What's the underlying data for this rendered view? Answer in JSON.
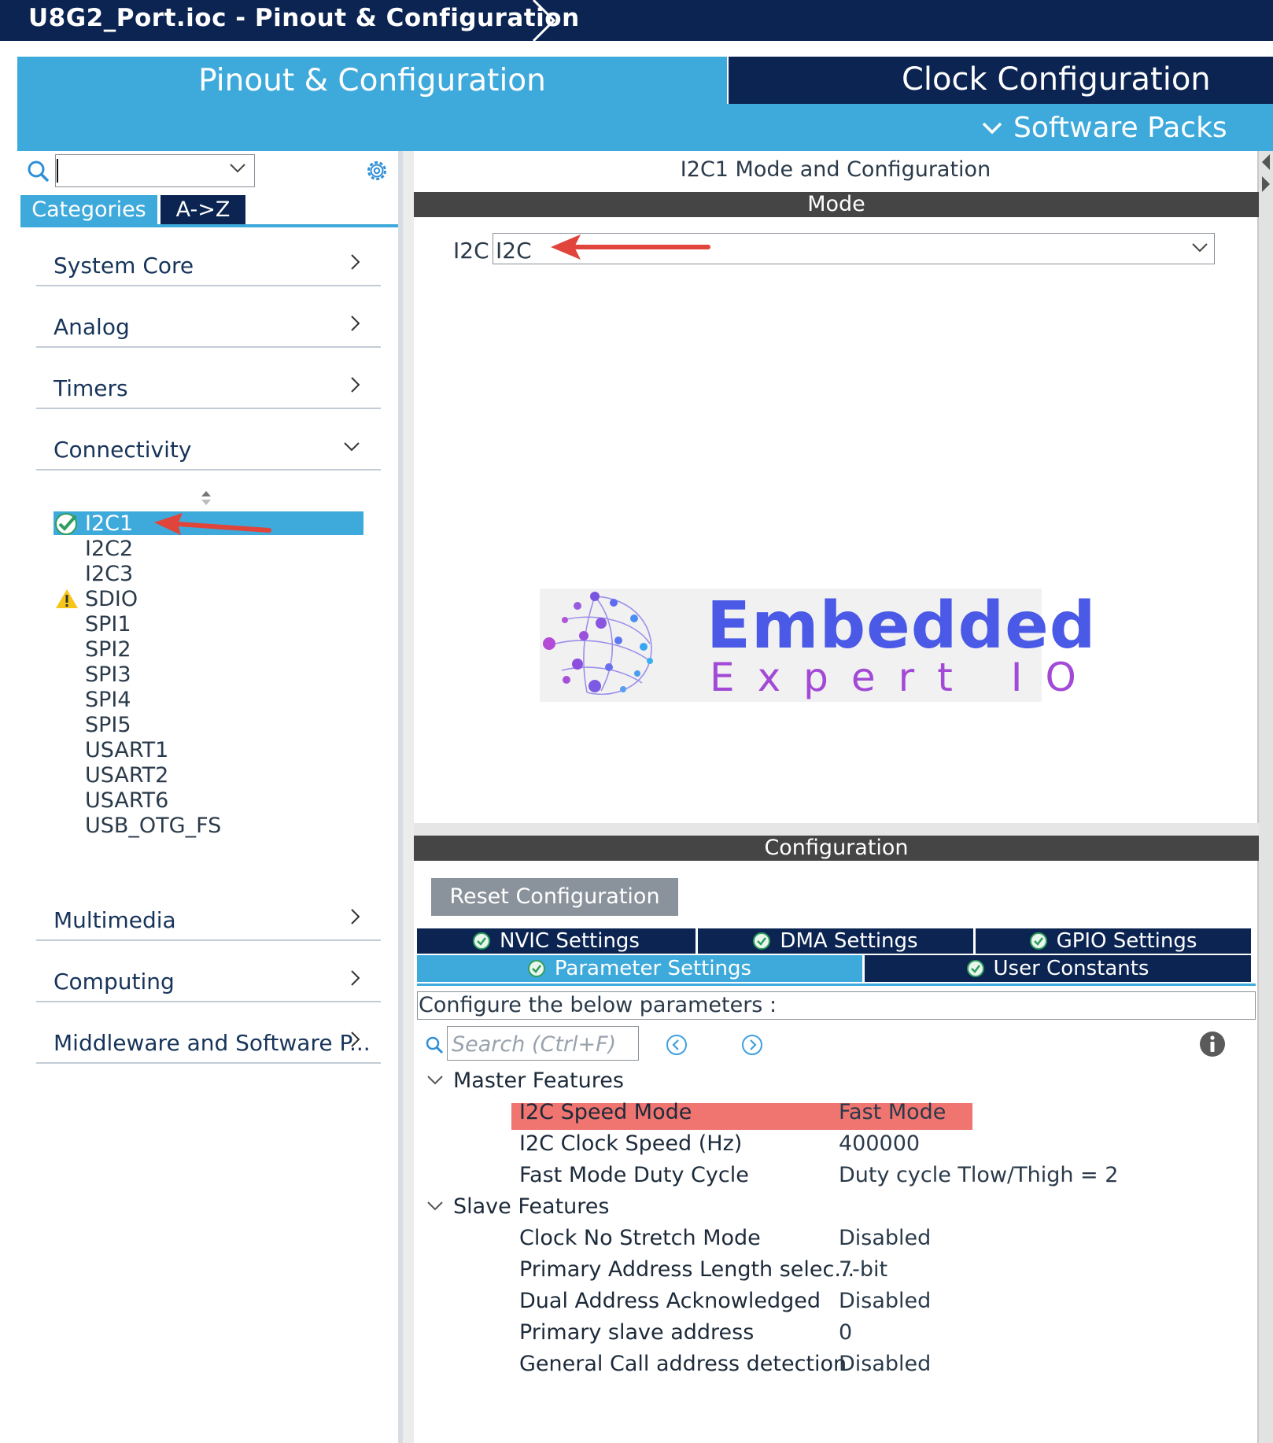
{
  "window": {
    "title": "U8G2_Port.ioc - Pinout & Configuration"
  },
  "top_tabs": {
    "pinout": "Pinout & Configuration",
    "clock": "Clock Configuration",
    "software_packs": "Software Packs"
  },
  "left_panel": {
    "search": {
      "value": "",
      "placeholder": ""
    },
    "tabs": {
      "categories": "Categories",
      "az": "A->Z"
    },
    "categories": [
      "System Core",
      "Analog",
      "Timers",
      "Connectivity",
      "Multimedia",
      "Computing",
      "Middleware and Software P..."
    ],
    "connectivity_items": [
      {
        "label": "I2C1",
        "status": "check"
      },
      {
        "label": "I2C2",
        "status": ""
      },
      {
        "label": "I2C3",
        "status": ""
      },
      {
        "label": "SDIO",
        "status": "warning"
      },
      {
        "label": "SPI1",
        "status": ""
      },
      {
        "label": "SPI2",
        "status": ""
      },
      {
        "label": "SPI3",
        "status": ""
      },
      {
        "label": "SPI4",
        "status": ""
      },
      {
        "label": "SPI5",
        "status": ""
      },
      {
        "label": "USART1",
        "status": ""
      },
      {
        "label": "USART2",
        "status": ""
      },
      {
        "label": "USART6",
        "status": ""
      },
      {
        "label": "USB_OTG_FS",
        "status": ""
      }
    ],
    "selected_item": "I2C1"
  },
  "mode": {
    "title": "I2C1 Mode and Configuration",
    "section": "Mode",
    "i2c_label": "I2C",
    "i2c_value": "I2C"
  },
  "logo": {
    "word1": "Embedded",
    "word2": "Expert IO"
  },
  "configuration": {
    "section": "Configuration",
    "reset_button": "Reset Configuration",
    "tabs": {
      "nvic": "NVIC Settings",
      "dma": "DMA Settings",
      "gpio": "GPIO Settings",
      "parameter": "Parameter Settings",
      "user_constants": "User Constants"
    },
    "configure_text": "Configure the below parameters :",
    "search_placeholder": "Search (Ctrl+F)",
    "groups": {
      "master": {
        "title": "Master Features",
        "params": [
          {
            "name": "I2C Speed Mode",
            "value": "Fast Mode"
          },
          {
            "name": "I2C Clock Speed (Hz)",
            "value": "400000"
          },
          {
            "name": "Fast Mode Duty Cycle",
            "value": "Duty cycle Tlow/Thigh = 2"
          }
        ]
      },
      "slave": {
        "title": "Slave Features",
        "params": [
          {
            "name": "Clock No Stretch Mode",
            "value": "Disabled"
          },
          {
            "name": "Primary Address Length selec...",
            "value": "7-bit"
          },
          {
            "name": "Dual Address Acknowledged",
            "value": "Disabled"
          },
          {
            "name": "Primary slave address",
            "value": "0"
          },
          {
            "name": "General Call address detection",
            "value": "Disabled"
          }
        ]
      }
    }
  },
  "colors": {
    "navy": "#0b2452",
    "accent_blue": "#3eaadb",
    "section_bar": "#454545",
    "highlight_row": "#f07470",
    "annotation_arrow": "#e0443a"
  }
}
